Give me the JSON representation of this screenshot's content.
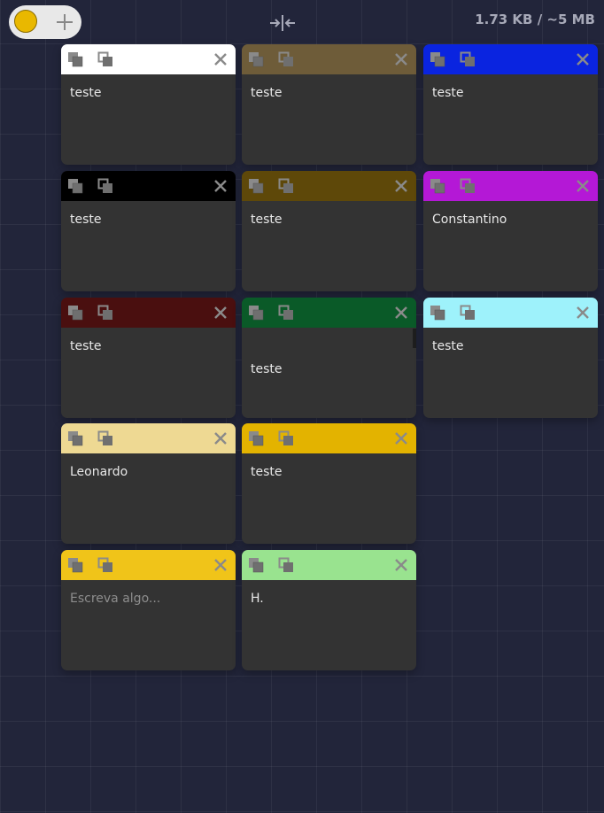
{
  "toolbar": {
    "color_picker_color": "#e9b800",
    "add_icon": "plus-icon",
    "collapse_icon": "collapse-horizontal-icon",
    "storage_text": "1.73 KB / ~5 MB"
  },
  "notes": [
    {
      "text": "teste",
      "color": "#ffffff"
    },
    {
      "text": "teste",
      "color": "#6e5c39"
    },
    {
      "text": "teste",
      "color": "#0a24e0"
    },
    {
      "text": "teste",
      "color": "#000000"
    },
    {
      "text": "teste",
      "color": "#5e4809"
    },
    {
      "text": "Constantino",
      "color": "#b418d6"
    },
    {
      "text": "teste",
      "color": "#4a0f0f"
    },
    {
      "text": "teste",
      "color": "#0a5a28"
    },
    {
      "text": "teste",
      "color": "#9ef2fb"
    },
    {
      "text": "Leonardo",
      "color": "#eed993"
    },
    {
      "text": "teste",
      "color": "#e3b300"
    },
    {
      "text": "",
      "placeholder": "Escreva algo...",
      "color": "#f0c419"
    },
    {
      "text": "H.",
      "color": "#99e38f"
    }
  ]
}
